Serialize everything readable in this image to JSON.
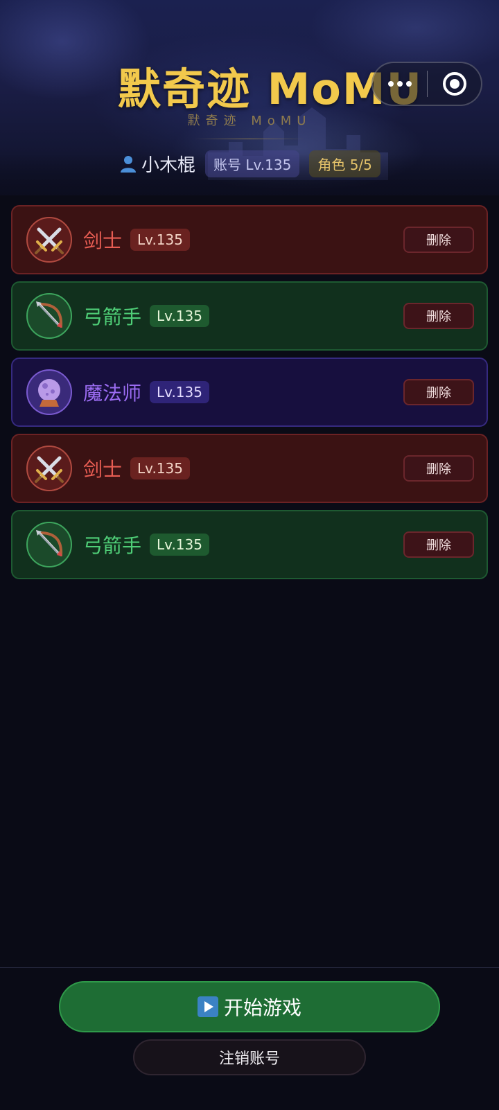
{
  "header": {
    "game_title": "默奇迹 MoMU",
    "subtitle": "默奇迹 MoMU",
    "username": "小木棍",
    "account_level": "账号 Lv.135",
    "role_count": "角色 5/5"
  },
  "characters": [
    {
      "class": "剑士",
      "level": "Lv.135",
      "icon": "crossed-swords-icon",
      "delete_label": "删除"
    },
    {
      "class": "弓箭手",
      "level": "Lv.135",
      "icon": "bow-and-arrow-icon",
      "delete_label": "删除"
    },
    {
      "class": "魔法师",
      "level": "Lv.135",
      "icon": "crystal-ball-icon",
      "delete_label": "删除"
    },
    {
      "class": "剑士",
      "level": "Lv.135",
      "icon": "crossed-swords-icon",
      "delete_label": "删除"
    },
    {
      "class": "弓箭手",
      "level": "Lv.135",
      "icon": "bow-and-arrow-icon",
      "delete_label": "删除"
    }
  ],
  "actions": {
    "start_game": "开始游戏",
    "logout": "注销账号"
  },
  "colors": {
    "title_gold": "#f2c94c",
    "warrior": "#e85d53",
    "archer": "#4fce77",
    "mage": "#9b6cf2",
    "start_button": "#1e6d34"
  }
}
